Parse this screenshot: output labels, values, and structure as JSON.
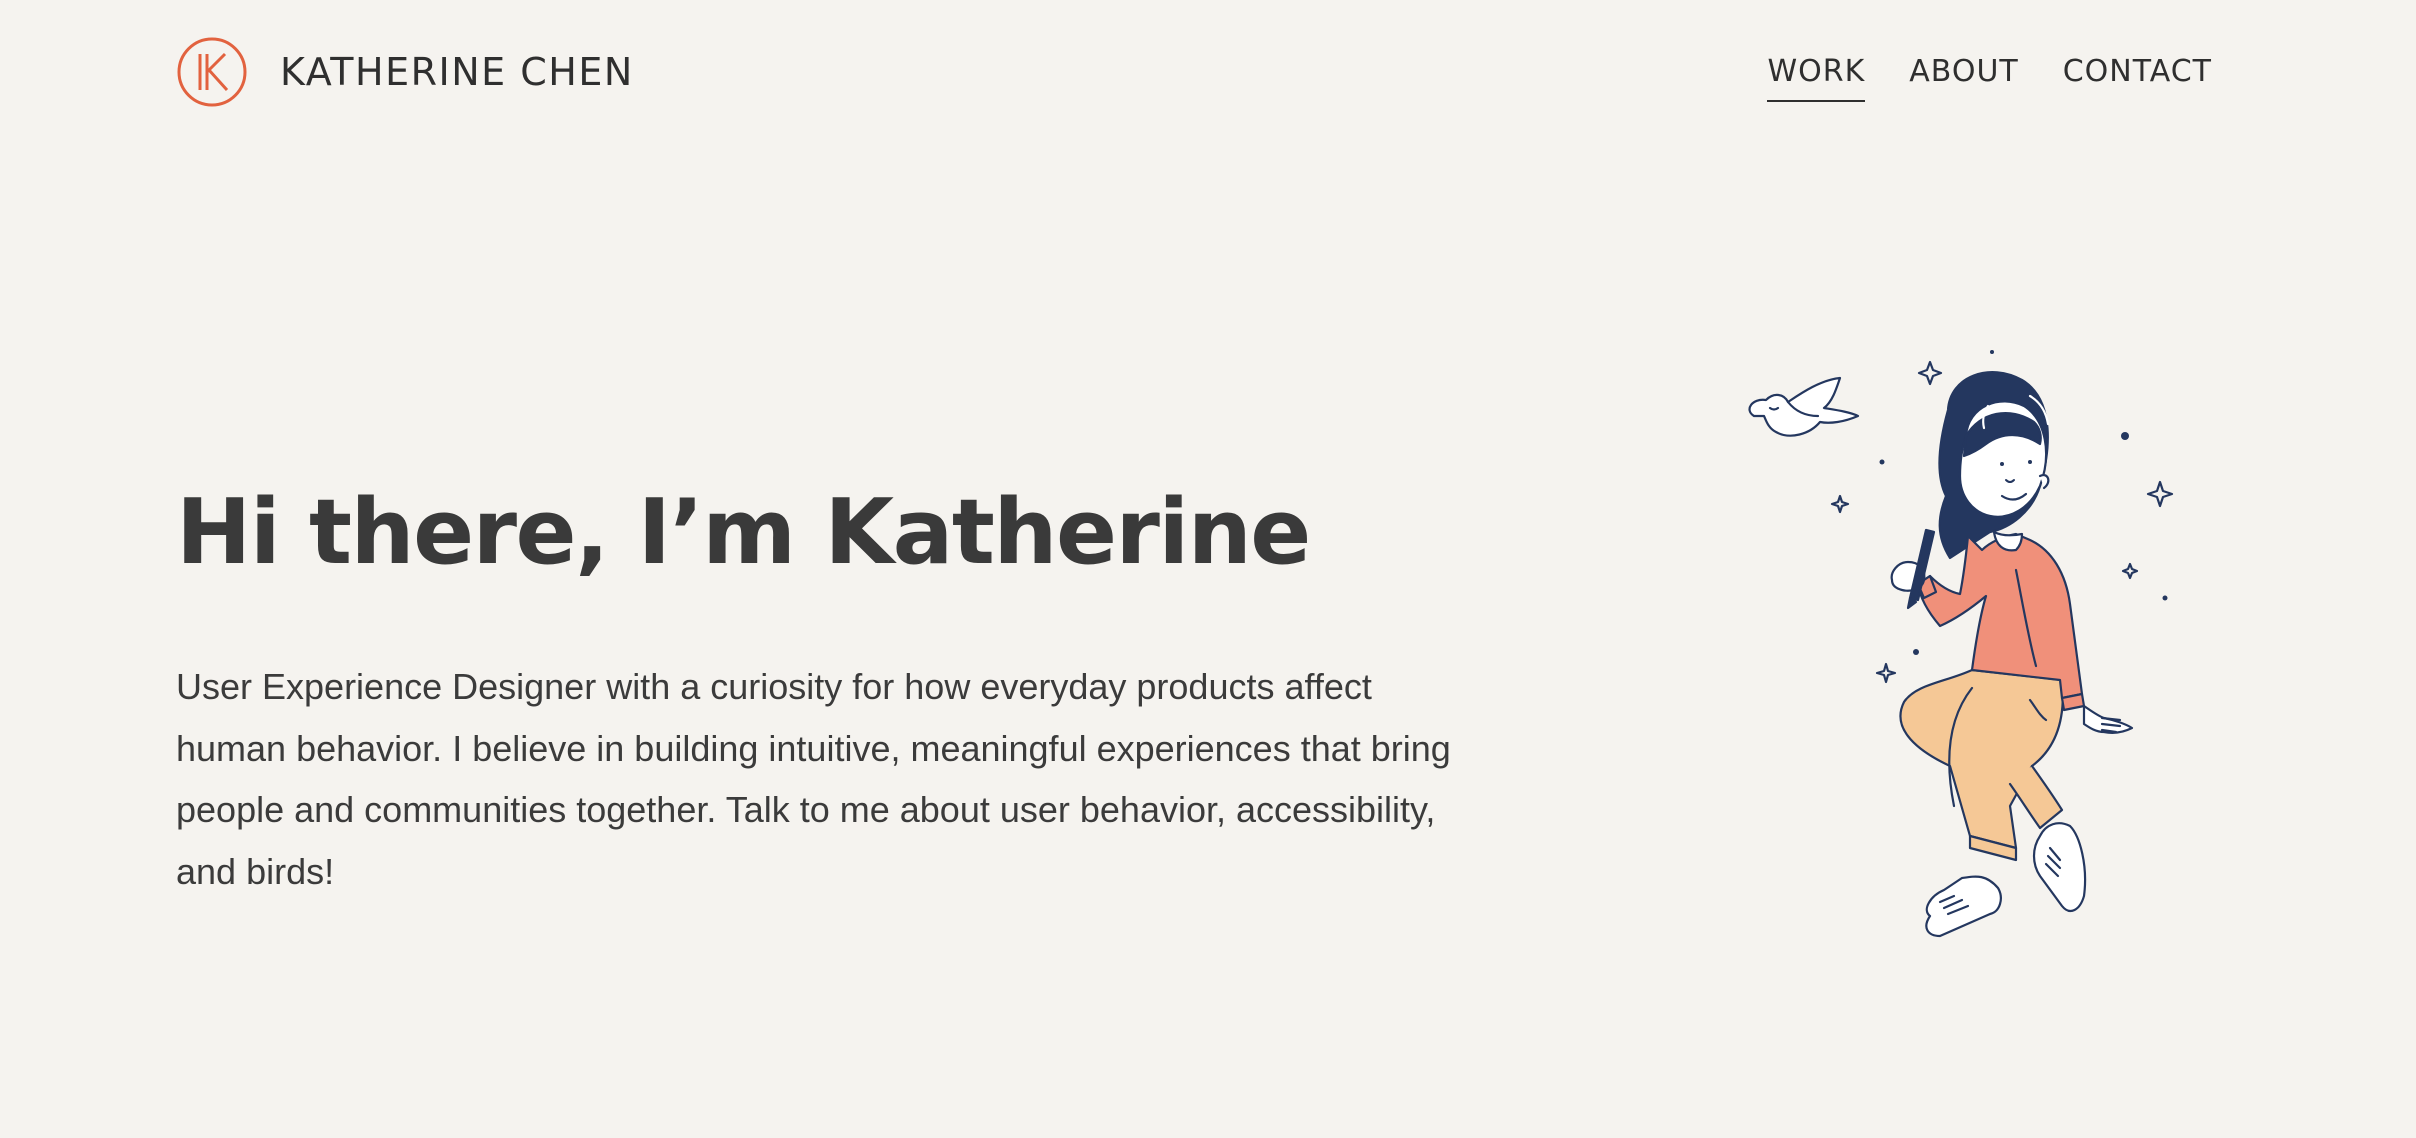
{
  "header": {
    "site_name": "KATHERINE CHEN",
    "logo_icon": "k-monogram-circle-icon",
    "nav": [
      {
        "label": "WORK",
        "active": true
      },
      {
        "label": "ABOUT",
        "active": false
      },
      {
        "label": "CONTACT",
        "active": false
      }
    ]
  },
  "hero": {
    "title": "Hi there, I’m Katherine",
    "description": "User Experience Designer with a curiosity for how everyday products affect human behavior. I believe in building intuitive, meaningful experiences that bring people and communities together. Talk to me about user behavior, accessibility, and birds!",
    "illustration_icon": "woman-with-pen-and-bird-illustration"
  },
  "colors": {
    "background": "#f5f3ef",
    "accent": "#e2623f",
    "text": "#3b3b3b",
    "navy": "#24375f",
    "coral": "#f0907a",
    "sand": "#f5c896"
  }
}
